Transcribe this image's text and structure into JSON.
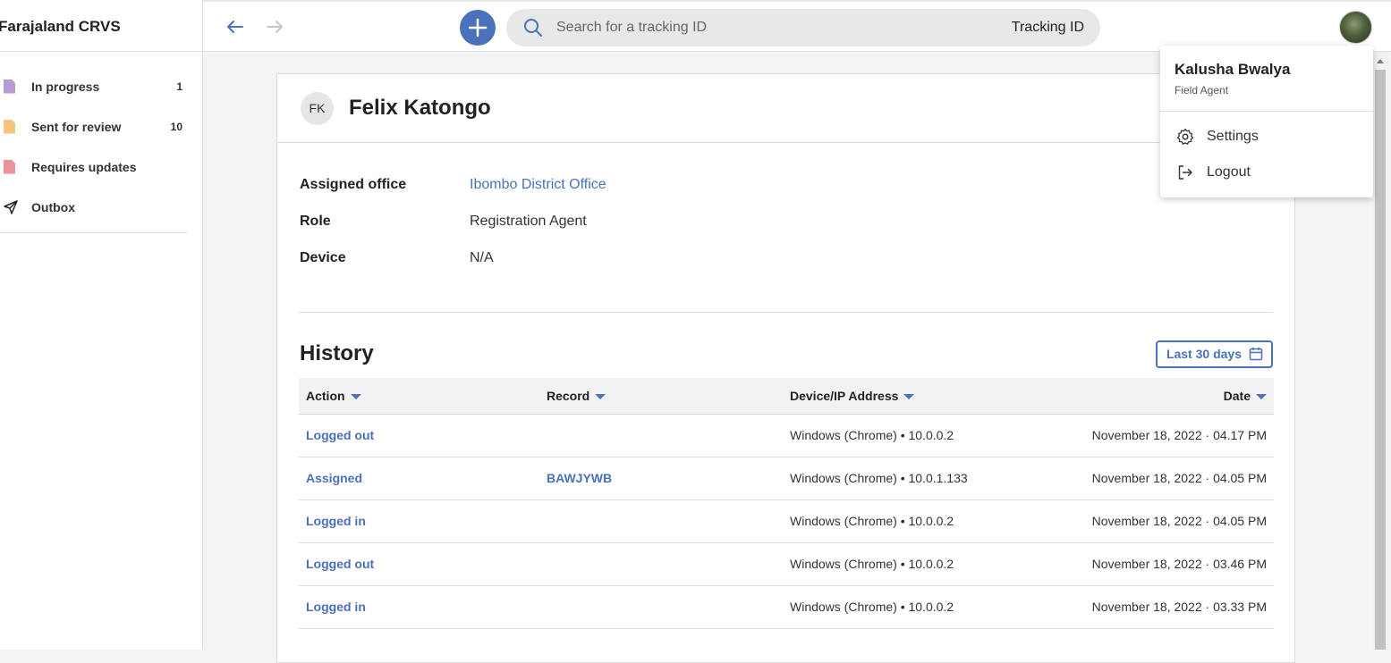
{
  "app": {
    "title": "Farajaland CRVS"
  },
  "sidebar": {
    "items": [
      {
        "label": "In progress",
        "count": "1",
        "icon": "document-purple-icon",
        "color": "#b99ad9"
      },
      {
        "label": "Sent for review",
        "count": "10",
        "icon": "document-orange-icon",
        "color": "#f5c47f"
      },
      {
        "label": "Requires updates",
        "count": "",
        "icon": "document-red-icon",
        "color": "#e9949c"
      },
      {
        "label": "Outbox",
        "count": "",
        "icon": "send-icon"
      }
    ]
  },
  "topbar": {
    "search": {
      "placeholder": "Search for a tracking ID",
      "type_label": "Tracking ID"
    }
  },
  "profile": {
    "initials": "FK",
    "name": "Felix Katongo",
    "fields": [
      {
        "label": "Assigned office",
        "value": "Ibombo District Office"
      },
      {
        "label": "Role",
        "value": "Registration Agent"
      },
      {
        "label": "Device",
        "value": "N/A"
      }
    ]
  },
  "history": {
    "title": "History",
    "filter_label": "Last 30 days",
    "columns": [
      "Action",
      "Record",
      "Device/IP Address",
      "Date"
    ],
    "rows": [
      {
        "action": "Logged out",
        "record": "",
        "device": "Windows (Chrome) • 10.0.0.2",
        "date": "November 18, 2022 · 04.17 PM"
      },
      {
        "action": "Assigned",
        "record": "BAWJYWB",
        "device": "Windows (Chrome) • 10.0.1.133",
        "date": "November 18, 2022 · 04.05 PM"
      },
      {
        "action": "Logged in",
        "record": "",
        "device": "Windows (Chrome) • 10.0.0.2",
        "date": "November 18, 2022 · 04.05 PM"
      },
      {
        "action": "Logged out",
        "record": "",
        "device": "Windows (Chrome) • 10.0.0.2",
        "date": "November 18, 2022 · 03.46 PM"
      },
      {
        "action": "Logged in",
        "record": "",
        "device": "Windows (Chrome) • 10.0.0.2",
        "date": "November 18, 2022 · 03.33 PM"
      }
    ]
  },
  "user_menu": {
    "name": "Kalusha Bwalya",
    "role": "Field Agent",
    "items": [
      {
        "label": "Settings",
        "icon": "gear-icon"
      },
      {
        "label": "Logout",
        "icon": "logout-icon"
      }
    ]
  },
  "colors": {
    "accent": "#4972bb"
  }
}
